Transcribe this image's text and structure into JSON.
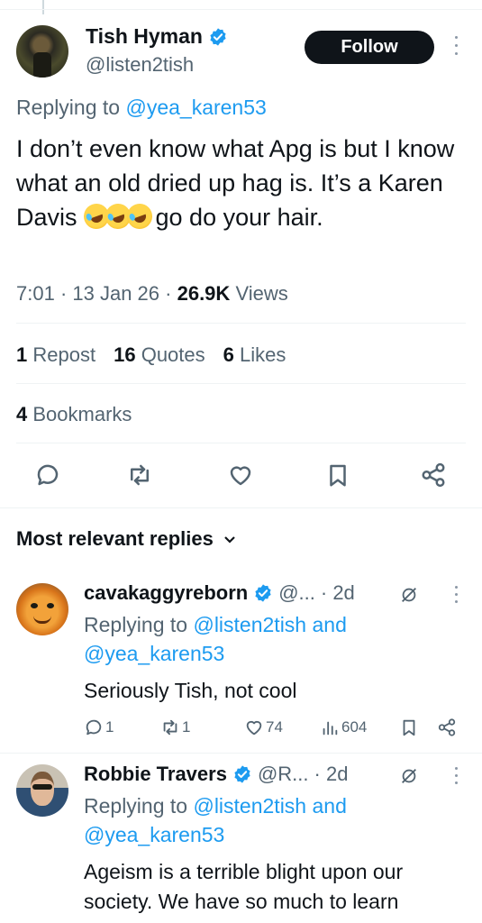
{
  "main_tweet": {
    "author_name": "Tish Hyman",
    "author_handle": "@listen2tish",
    "follow_label": "Follow",
    "replying_prefix": "Replying to ",
    "replying_handle": "@yea_karen53",
    "text_before_emoji": "I don’t even know what Apg is but I know what an old dried up hag is. It’s a Karen Davis ",
    "emoji_name": "rolling-on-floor-laughing",
    "text_after_emoji": " go do your hair.",
    "time": "7:01",
    "date": "13 Jan 26",
    "views_count": "26.9K",
    "views_label": "Views",
    "reposts_count": "1",
    "reposts_label": "Repost",
    "quotes_count": "16",
    "quotes_label": "Quotes",
    "likes_count": "6",
    "likes_label": "Likes",
    "bookmarks_count": "4",
    "bookmarks_label": "Bookmarks"
  },
  "replies_section": {
    "title": "Most relevant replies"
  },
  "replies": [
    {
      "name": "cavakaggyreborn",
      "handle": "@...",
      "age": "· 2d",
      "replying_prefix": "Replying to ",
      "replying_to_1": "@listen2tish",
      "replying_and": " and",
      "replying_to_2": "@yea_karen53",
      "text": "Seriously Tish, not cool",
      "replies": "1",
      "reposts": "1",
      "likes": "74",
      "views": "604"
    },
    {
      "name": "Robbie Travers",
      "handle": "@R...",
      "age": "· 2d",
      "replying_prefix": "Replying to ",
      "replying_to_1": "@listen2tish",
      "replying_and": " and",
      "replying_to_2": "@yea_karen53",
      "text": "Ageism is a terrible blight upon our society. We have so much to learn"
    }
  ],
  "colors": {
    "accent": "#1d9bf0",
    "text": "#0f1419",
    "secondary": "#536471",
    "follow_bg": "#0f1419"
  }
}
